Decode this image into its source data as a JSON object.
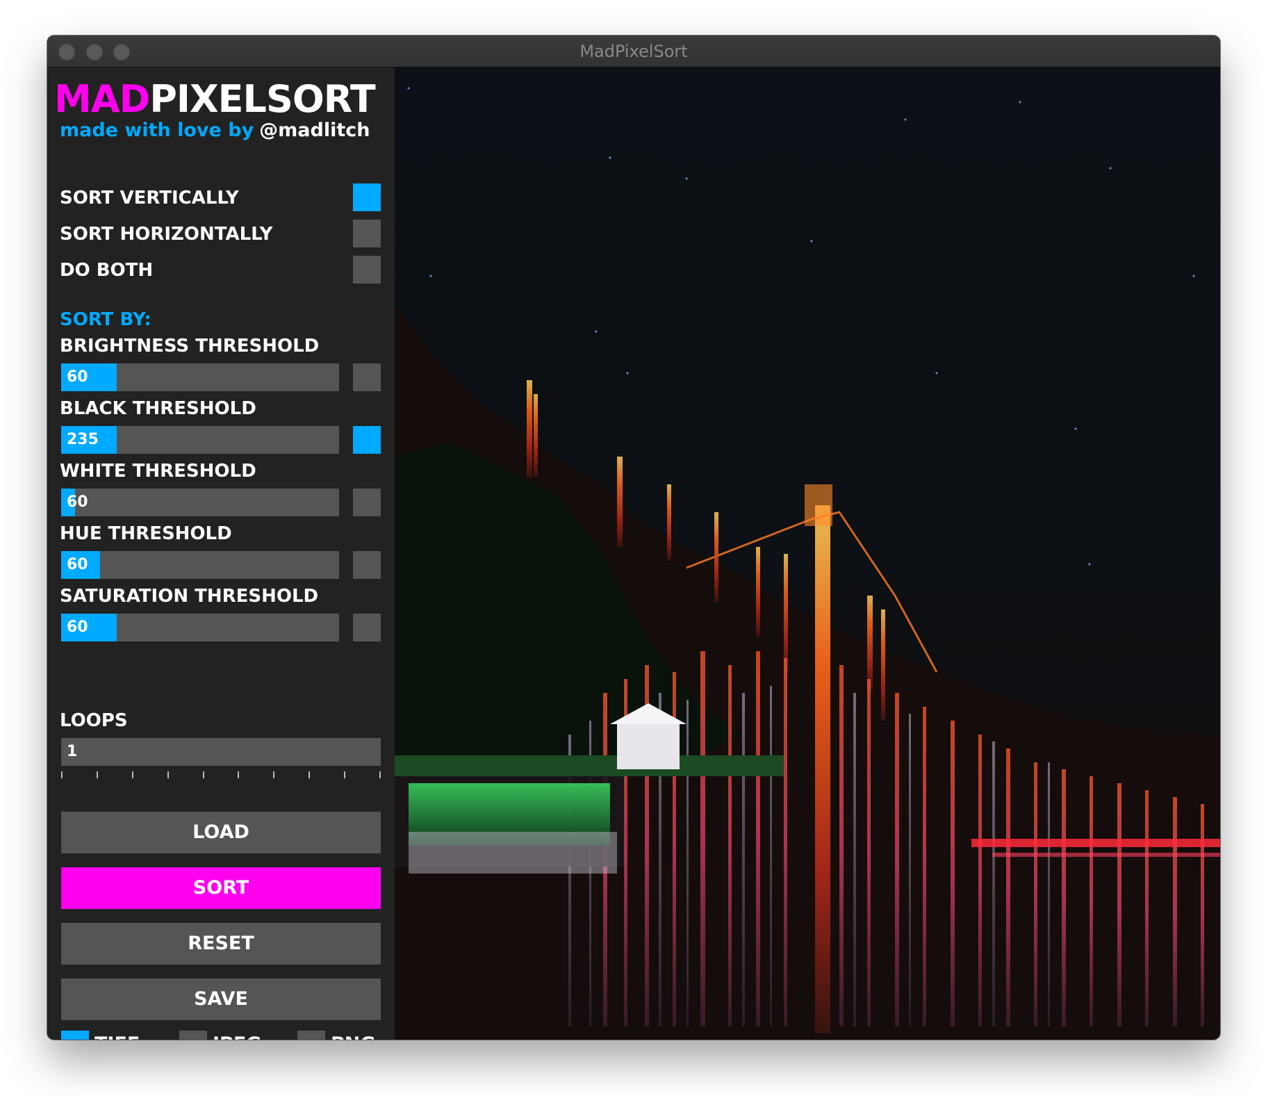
{
  "window": {
    "title": "MadPixelSort"
  },
  "brand": {
    "name_part1": "MAD",
    "name_part2": "PIXELSORT",
    "tagline": "made with love by",
    "handle": "@madlitch"
  },
  "colors": {
    "accent_blue": "#00aaff",
    "accent_pink": "#ff00ee",
    "control_gray": "#555555",
    "panel_bg": "#222222"
  },
  "sort_direction": [
    {
      "label": "SORT VERTICALLY",
      "checked": true
    },
    {
      "label": "SORT HORIZONTALLY",
      "checked": false
    },
    {
      "label": "DO BOTH",
      "checked": false
    }
  ],
  "sort_by": {
    "heading": "SORT BY:",
    "thresholds": [
      {
        "label": "BRIGHTNESS THRESHOLD",
        "value": "60",
        "fill_fraction": 0.2,
        "enabled": false
      },
      {
        "label": "BLACK THRESHOLD",
        "value": "235",
        "fill_fraction": 0.2,
        "enabled": true
      },
      {
        "label": "WHITE THRESHOLD",
        "value": "60",
        "fill_fraction": 0.05,
        "enabled": false
      },
      {
        "label": "HUE THRESHOLD",
        "value": "60",
        "fill_fraction": 0.14,
        "enabled": false
      },
      {
        "label": "SATURATION THRESHOLD",
        "value": "60",
        "fill_fraction": 0.2,
        "enabled": false
      }
    ]
  },
  "loops": {
    "label": "LOOPS",
    "value": "1",
    "tick_count": 10
  },
  "buttons": {
    "load": "LOAD",
    "sort": "SORT",
    "reset": "RESET",
    "save": "SAVE"
  },
  "formats": [
    {
      "label": "TIFF",
      "selected": true
    },
    {
      "label": "JPEG",
      "selected": false
    },
    {
      "label": "PNG",
      "selected": false
    }
  ]
}
